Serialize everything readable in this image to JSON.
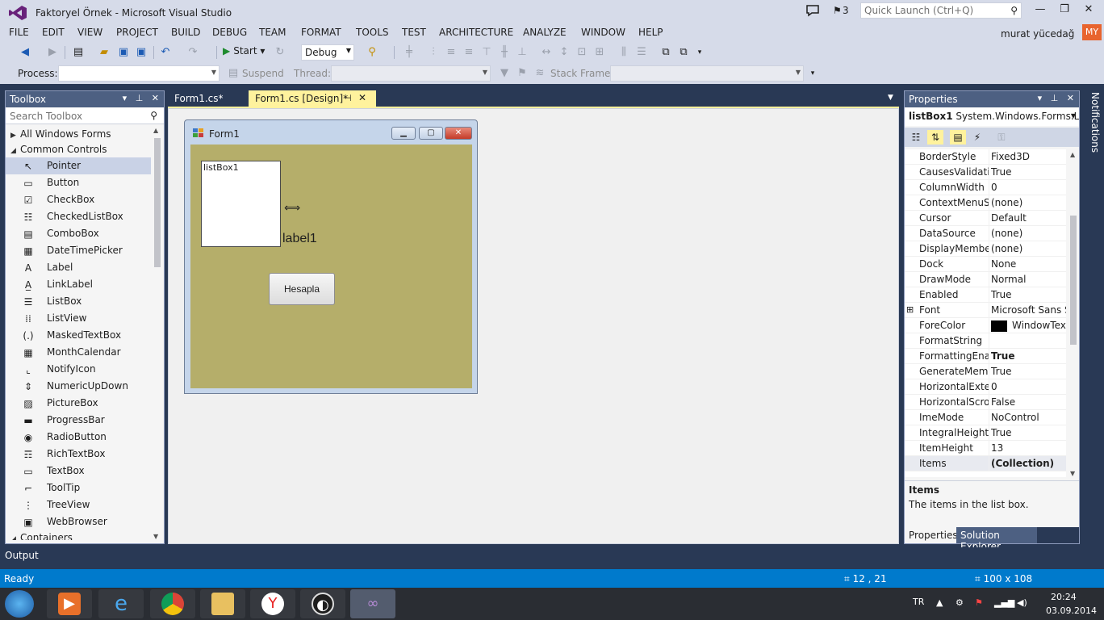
{
  "window": {
    "title": "Faktoryel Örnek - Microsoft Visual Studio",
    "notification_count": "3",
    "quick_launch_placeholder": "Quick Launch (Ctrl+Q)",
    "user_name": "murat yücedağ",
    "user_initials": "MY"
  },
  "menu": [
    "FILE",
    "EDIT",
    "VIEW",
    "PROJECT",
    "BUILD",
    "DEBUG",
    "TEAM",
    "FORMAT",
    "TOOLS",
    "TEST",
    "ARCHITECTURE",
    "ANALYZE",
    "WINDOW",
    "HELP"
  ],
  "toolbar": {
    "start_label": "Start",
    "config_value": "Debug"
  },
  "debug_toolbar": {
    "process_label": "Process:",
    "suspend_label": "Suspend",
    "thread_label": "Thread:",
    "stack_frame_label": "Stack Frame:"
  },
  "toolbox": {
    "title": "Toolbox",
    "search_placeholder": "Search Toolbox",
    "groups": {
      "all_windows_forms": "All Windows Forms",
      "common_controls": "Common Controls",
      "containers": "Containers"
    },
    "items": [
      "Pointer",
      "Button",
      "CheckBox",
      "CheckedListBox",
      "ComboBox",
      "DateTimePicker",
      "Label",
      "LinkLabel",
      "ListBox",
      "ListView",
      "MaskedTextBox",
      "MonthCalendar",
      "NotifyIcon",
      "NumericUpDown",
      "PictureBox",
      "ProgressBar",
      "RadioButton",
      "RichTextBox",
      "TextBox",
      "ToolTip",
      "TreeView",
      "WebBrowser"
    ]
  },
  "doc_tabs": {
    "tab1": "Form1.cs*",
    "tab2": "Form1.cs [Design]*"
  },
  "form": {
    "title": "Form1",
    "listbox_text": "listBox1",
    "label_text": "label1",
    "button_text": "Hesapla"
  },
  "properties": {
    "title": "Properties",
    "object_name": "listBox1",
    "object_type": "System.Windows.Forms.List",
    "rows": [
      {
        "name": "BorderStyle",
        "value": "Fixed3D"
      },
      {
        "name": "CausesValidatio",
        "value": "True"
      },
      {
        "name": "ColumnWidth",
        "value": "0"
      },
      {
        "name": "ContextMenuStr",
        "value": "(none)"
      },
      {
        "name": "Cursor",
        "value": "Default"
      },
      {
        "name": "DataSource",
        "value": "(none)"
      },
      {
        "name": "DisplayMember",
        "value": "(none)"
      },
      {
        "name": "Dock",
        "value": "None"
      },
      {
        "name": "DrawMode",
        "value": "Normal"
      },
      {
        "name": "Enabled",
        "value": "True"
      },
      {
        "name": "Font",
        "value": "Microsoft Sans Se"
      },
      {
        "name": "ForeColor",
        "value": "WindowText"
      },
      {
        "name": "FormatString",
        "value": ""
      },
      {
        "name": "FormattingEnab",
        "value": "True"
      },
      {
        "name": "GenerateMembe",
        "value": "True"
      },
      {
        "name": "HorizontalExten",
        "value": "0"
      },
      {
        "name": "HorizontalScroll",
        "value": "False"
      },
      {
        "name": "ImeMode",
        "value": "NoControl"
      },
      {
        "name": "IntegralHeight",
        "value": "True"
      },
      {
        "name": "ItemHeight",
        "value": "13"
      },
      {
        "name": "Items",
        "value": "(Collection)"
      }
    ],
    "desc_title": "Items",
    "desc_text": "The items in the list box.",
    "tab_properties": "Properties",
    "tab_solution_explorer": "Solution Explorer"
  },
  "notifications_label": "Notifications",
  "output_label": "Output",
  "status": {
    "text": "Ready",
    "position": "12 , 21",
    "size": "100 x 108"
  },
  "taskbar": {
    "language": "TR",
    "time": "20:24",
    "date": "03.09.2014"
  },
  "colors": {
    "accent": "#007acc",
    "panel_header": "#4d6082",
    "active_tab": "#fff29d",
    "form_client": "#b5ae6a"
  }
}
